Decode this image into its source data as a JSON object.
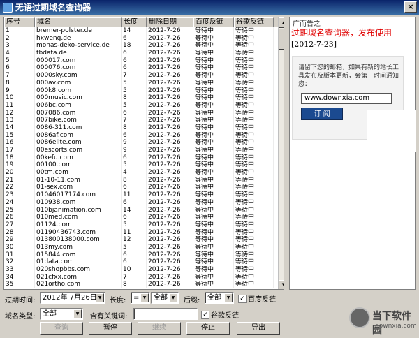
{
  "window": {
    "title": "无语过期域名查询器",
    "close": "×"
  },
  "grid": {
    "columns": [
      "序号",
      "域名",
      "长度",
      "删除日期",
      "百度反链",
      "谷歌反链"
    ],
    "rows": [
      [
        "1",
        "bremer-polster.de",
        "14",
        "2012-7-26",
        "等待中",
        "等待中"
      ],
      [
        "2",
        "hxweng.de",
        "6",
        "2012-7-26",
        "等待中",
        "等待中"
      ],
      [
        "3",
        "monas-deko-service.de",
        "18",
        "2012-7-26",
        "等待中",
        "等待中"
      ],
      [
        "4",
        "tbdata.de",
        "6",
        "2012-7-26",
        "等待中",
        "等待中"
      ],
      [
        "5",
        "000017.com",
        "6",
        "2012-7-26",
        "等待中",
        "等待中"
      ],
      [
        "6",
        "000076.com",
        "6",
        "2012-7-26",
        "等待中",
        "等待中"
      ],
      [
        "7",
        "0000sky.com",
        "7",
        "2012-7-26",
        "等待中",
        "等待中"
      ],
      [
        "8",
        "000av.com",
        "5",
        "2012-7-26",
        "等待中",
        "等待中"
      ],
      [
        "9",
        "000k8.com",
        "5",
        "2012-7-26",
        "等待中",
        "等待中"
      ],
      [
        "10",
        "000music.com",
        "8",
        "2012-7-26",
        "等待中",
        "等待中"
      ],
      [
        "11",
        "006bc.com",
        "5",
        "2012-7-26",
        "等待中",
        "等待中"
      ],
      [
        "12",
        "007086.com",
        "6",
        "2012-7-26",
        "等待中",
        "等待中"
      ],
      [
        "13",
        "007bike.com",
        "7",
        "2012-7-26",
        "等待中",
        "等待中"
      ],
      [
        "14",
        "0086-311.com",
        "8",
        "2012-7-26",
        "等待中",
        "等待中"
      ],
      [
        "15",
        "0086af.com",
        "6",
        "2012-7-26",
        "等待中",
        "等待中"
      ],
      [
        "16",
        "0086elite.com",
        "9",
        "2012-7-26",
        "等待中",
        "等待中"
      ],
      [
        "17",
        "00escorts.com",
        "9",
        "2012-7-26",
        "等待中",
        "等待中"
      ],
      [
        "18",
        "00kefu.com",
        "6",
        "2012-7-26",
        "等待中",
        "等待中"
      ],
      [
        "19",
        "00100.com",
        "5",
        "2012-7-26",
        "等待中",
        "等待中"
      ],
      [
        "20",
        "00tm.com",
        "4",
        "2012-7-26",
        "等待中",
        "等待中"
      ],
      [
        "21",
        "01-10-11.com",
        "8",
        "2012-7-26",
        "等待中",
        "等待中"
      ],
      [
        "22",
        "01-sex.com",
        "6",
        "2012-7-26",
        "等待中",
        "等待中"
      ],
      [
        "23",
        "01046017174.com",
        "11",
        "2012-7-26",
        "等待中",
        "等待中"
      ],
      [
        "24",
        "010938.com",
        "6",
        "2012-7-26",
        "等待中",
        "等待中"
      ],
      [
        "25",
        "010bjanimation.com",
        "14",
        "2012-7-26",
        "等待中",
        "等待中"
      ],
      [
        "26",
        "010med.com",
        "6",
        "2012-7-26",
        "等待中",
        "等待中"
      ],
      [
        "27",
        "01124.com",
        "5",
        "2012-7-26",
        "等待中",
        "等待中"
      ],
      [
        "28",
        "01190436743.com",
        "11",
        "2012-7-26",
        "等待中",
        "等待中"
      ],
      [
        "29",
        "013800138000.com",
        "12",
        "2012-7-26",
        "等待中",
        "等待中"
      ],
      [
        "30",
        "013my.com",
        "5",
        "2012-7-26",
        "等待中",
        "等待中"
      ],
      [
        "31",
        "015844.com",
        "6",
        "2012-7-26",
        "等待中",
        "等待中"
      ],
      [
        "32",
        "01data.com",
        "6",
        "2012-7-26",
        "等待中",
        "等待中"
      ],
      [
        "33",
        "020shopbbs.com",
        "10",
        "2012-7-26",
        "等待中",
        "等待中"
      ],
      [
        "34",
        "021cfxx.com",
        "7",
        "2012-7-26",
        "等待中",
        "等待中"
      ],
      [
        "35",
        "021ortho.com",
        "8",
        "2012-7-26",
        "等待中",
        "等待中"
      ]
    ]
  },
  "ad": {
    "header": "广而告之",
    "title": "过期域名查询器，发布使用",
    "date": "[2012-7-23]",
    "text": "请留下您的邮箱，如果有新的站长工具发布及版本更新，会第一时间通知您：",
    "email_value": "www.downxia.com",
    "subscribe": "订 阅"
  },
  "filters": {
    "expire_label": "过期时间:",
    "expire_value": "2012年 7月26日",
    "length_label": "长度:",
    "length_op": "=",
    "length_value": "全部",
    "suffix_label": "后缀:",
    "suffix_value": "全部",
    "baidu_backlink": "百度反链",
    "domain_type_label": "域名类型:",
    "domain_type_value": "全部",
    "keyword_label": "含有关键词:",
    "keyword_value": "",
    "google_backlink": "谷歌反链"
  },
  "buttons": {
    "query": "查询",
    "pause": "暂停",
    "continue": "继续",
    "stop": "停止",
    "export": "导出"
  },
  "logo": {
    "name": "当下软件园",
    "url": "downxia.com"
  }
}
